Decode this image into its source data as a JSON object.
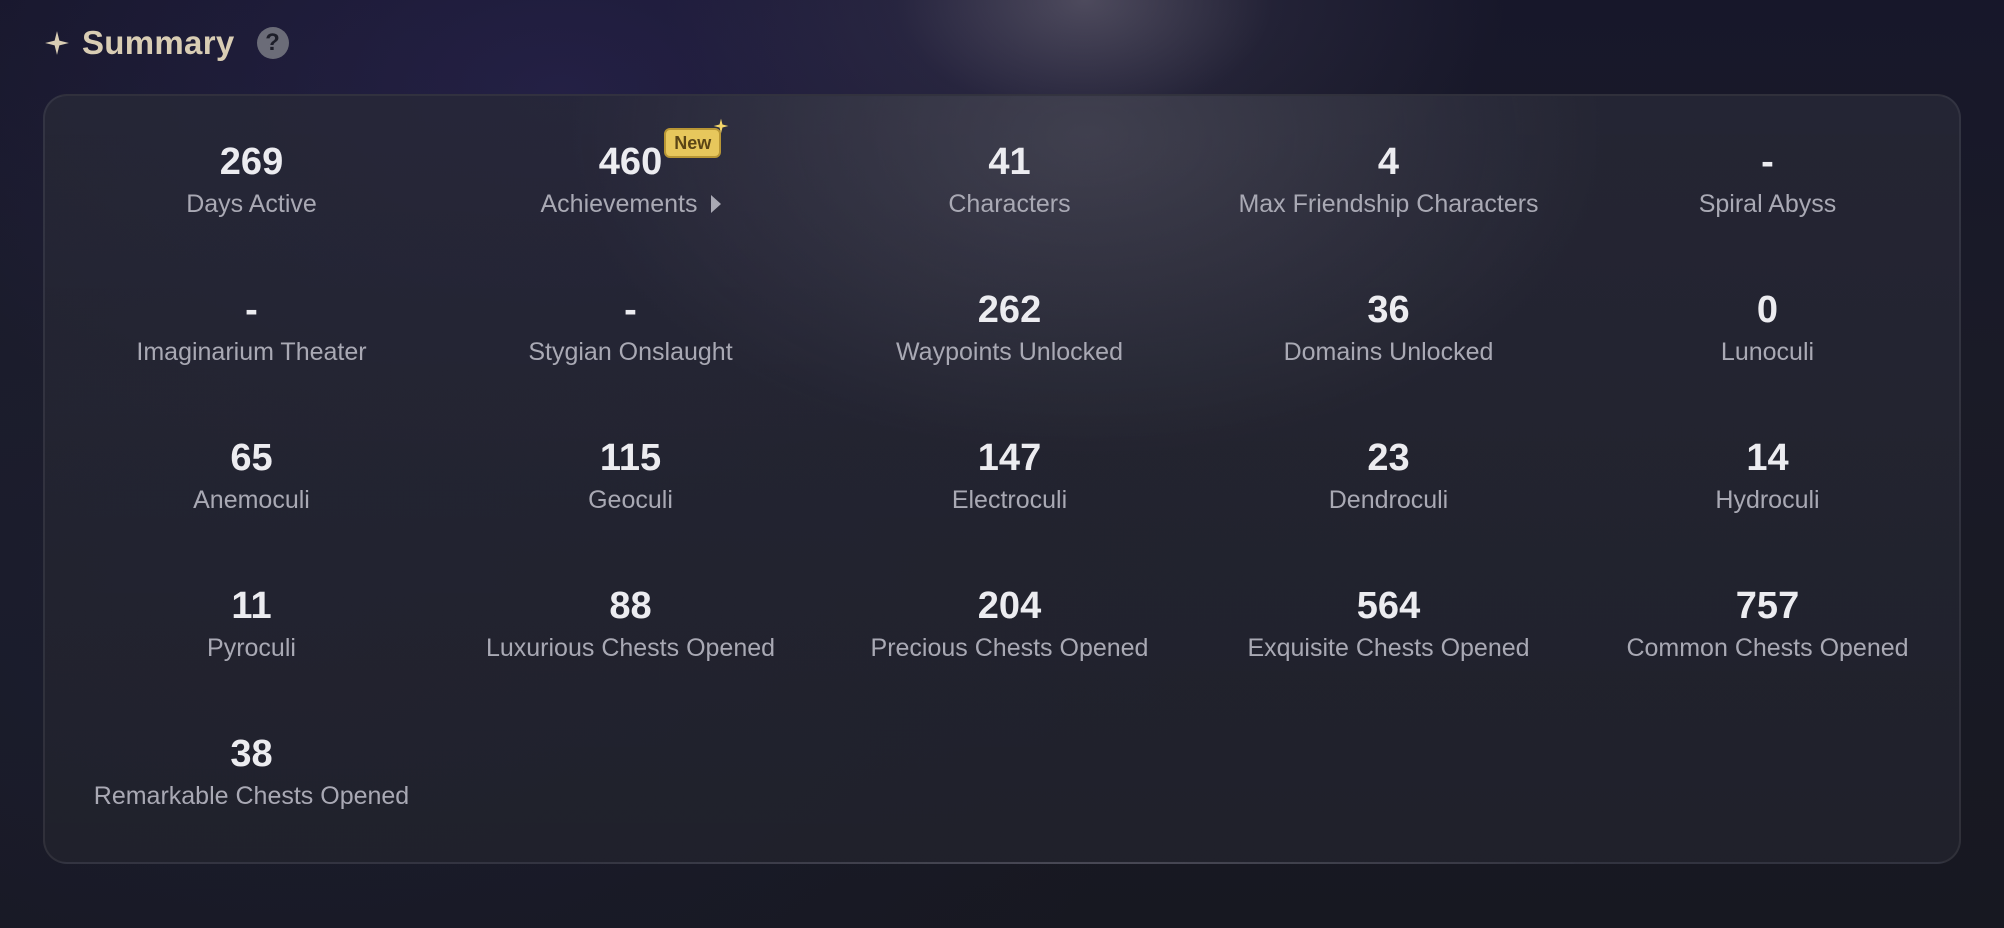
{
  "header": {
    "title": "Summary",
    "title_icon": "sparkle-icon",
    "help_icon": "question-circle-icon",
    "help_glyph": "?"
  },
  "colors": {
    "title": "#d9cdb4",
    "value": "#ececf0",
    "label": "#a9a9b4",
    "badge_bg": "#e7c75c"
  },
  "stats": [
    {
      "value": "269",
      "label": "Days Active"
    },
    {
      "value": "460",
      "label": "Achievements",
      "badge": "New",
      "link": true
    },
    {
      "value": "41",
      "label": "Characters"
    },
    {
      "value": "4",
      "label": "Max Friendship Characters"
    },
    {
      "value": "-",
      "label": "Spiral Abyss"
    },
    {
      "value": "-",
      "label": "Imaginarium Theater"
    },
    {
      "value": "-",
      "label": "Stygian Onslaught"
    },
    {
      "value": "262",
      "label": "Waypoints Unlocked"
    },
    {
      "value": "36",
      "label": "Domains Unlocked"
    },
    {
      "value": "0",
      "label": "Lunoculi"
    },
    {
      "value": "65",
      "label": "Anemoculi"
    },
    {
      "value": "115",
      "label": "Geoculi"
    },
    {
      "value": "147",
      "label": "Electroculi"
    },
    {
      "value": "23",
      "label": "Dendroculi"
    },
    {
      "value": "14",
      "label": "Hydroculi"
    },
    {
      "value": "11",
      "label": "Pyroculi"
    },
    {
      "value": "88",
      "label": "Luxurious Chests Opened"
    },
    {
      "value": "204",
      "label": "Precious Chests Opened"
    },
    {
      "value": "564",
      "label": "Exquisite Chests Opened"
    },
    {
      "value": "757",
      "label": "Common Chests Opened"
    },
    {
      "value": "38",
      "label": "Remarkable Chests Opened"
    }
  ]
}
